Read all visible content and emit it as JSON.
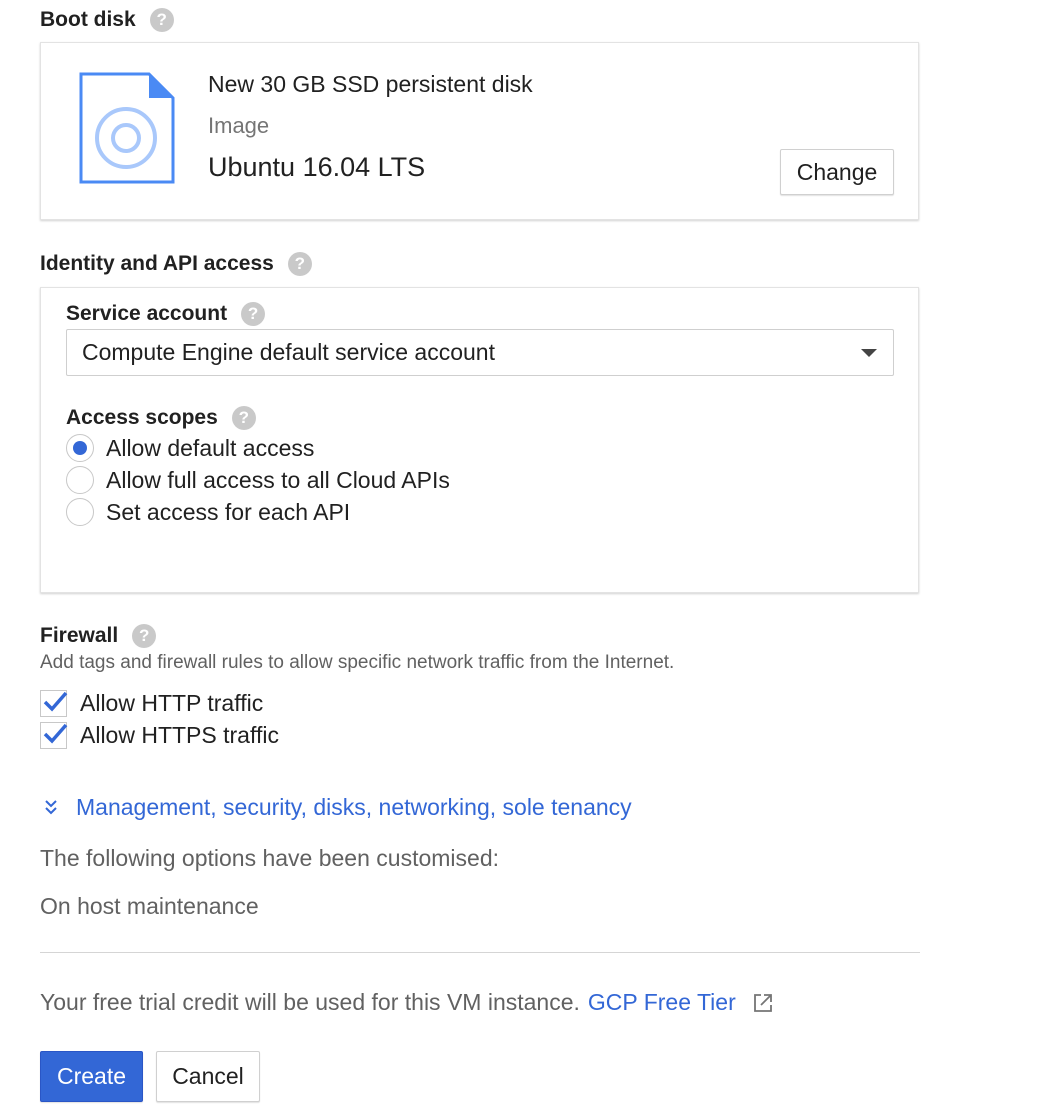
{
  "boot_disk": {
    "title": "Boot disk",
    "help": "?",
    "disk_title": "New 30 GB SSD persistent disk",
    "image_label": "Image",
    "image_name": "Ubuntu 16.04 LTS",
    "change_label": "Change"
  },
  "identity": {
    "title": "Identity and API access",
    "help": "?",
    "service_account": {
      "label": "Service account",
      "help": "?",
      "selected": "Compute Engine default service account"
    },
    "access_scopes": {
      "label": "Access scopes",
      "help": "?",
      "options": [
        {
          "label": "Allow default access",
          "selected": true
        },
        {
          "label": "Allow full access to all Cloud APIs",
          "selected": false
        },
        {
          "label": "Set access for each API",
          "selected": false
        }
      ]
    }
  },
  "firewall": {
    "title": "Firewall",
    "help": "?",
    "description": "Add tags and firewall rules to allow specific network traffic from the Internet.",
    "options": [
      {
        "label": "Allow HTTP traffic",
        "checked": true
      },
      {
        "label": "Allow HTTPS traffic",
        "checked": true
      }
    ]
  },
  "advanced": {
    "link_label": "Management, security, disks, networking, sole tenancy",
    "customised_text": "The following options have been customised:",
    "customised_item": "On host maintenance"
  },
  "footer": {
    "trial_text": "Your free trial credit will be used for this VM instance.",
    "trial_link": "GCP Free Tier",
    "create_label": "Create",
    "cancel_label": "Cancel"
  },
  "colors": {
    "accent": "#3367d6",
    "disk_icon": "#4285f4"
  },
  "icons": [
    "help-icon",
    "disk-icon",
    "dropdown-caret-icon",
    "checkmark-icon",
    "chevron-expand-icon",
    "external-link-icon"
  ]
}
